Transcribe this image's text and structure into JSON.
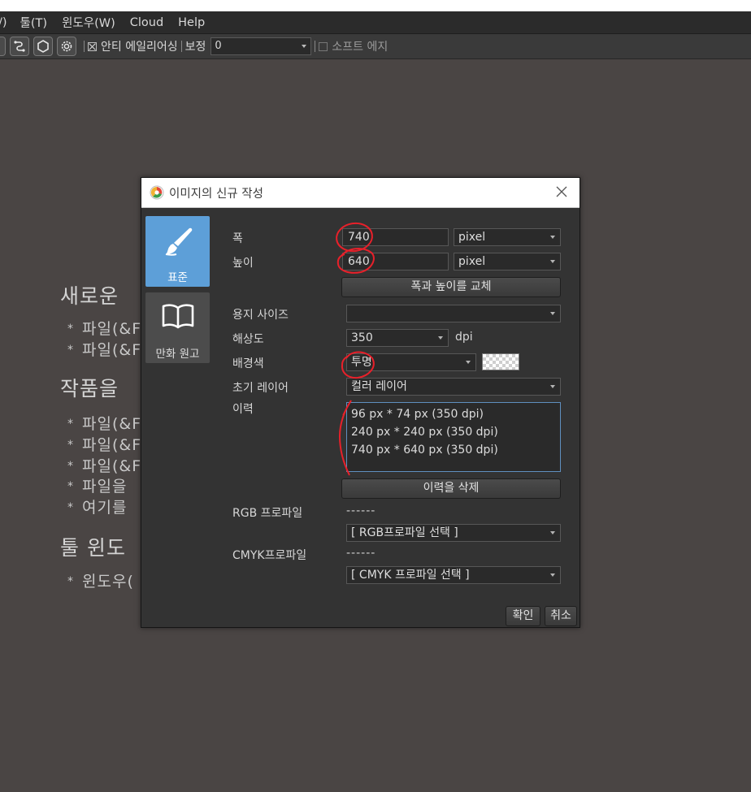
{
  "menubar": {
    "items": [
      "/)",
      "툴(T)",
      "윈도우(W)",
      "Cloud",
      "Help"
    ]
  },
  "toolbar": {
    "anti_alias_label": "안티 에일리어싱",
    "correction_label": "보정",
    "correction_value": "0",
    "soft_edge_label": "소프트 에지"
  },
  "background": {
    "headings": [
      "새로운",
      "작품을",
      "툴 윈도"
    ],
    "items_new": [
      "파일(&F",
      "파일(&F"
    ],
    "items_open": [
      "파일(&F",
      "파일(&F",
      "파일(&F",
      "파일을",
      "여기를"
    ],
    "items_tool": [
      "윈도우("
    ]
  },
  "dialog": {
    "title": "이미지의 신규 작성",
    "tabs": [
      {
        "label": "표준",
        "icon": "brush-icon"
      },
      {
        "label": "만화 원고",
        "icon": "book-icon"
      }
    ],
    "width_label": "폭",
    "width_value": "740",
    "width_unit": "pixel",
    "height_label": "높이",
    "height_value": "640",
    "height_unit": "pixel",
    "swap_button": "폭과 높이를 교체",
    "paper_size_label": "용지 사이즈",
    "paper_size_value": "",
    "resolution_label": "해상도",
    "resolution_value": "350",
    "resolution_unit": "dpi",
    "bg_color_label": "배경색",
    "bg_color_value": "투명",
    "initial_layer_label": "초기 레이어",
    "initial_layer_value": "컬러 레이어",
    "history_label": "이력",
    "history": [
      "96 px * 74 px (350 dpi)",
      "240 px * 240 px (350 dpi)",
      "740 px * 640 px (350 dpi)"
    ],
    "delete_history_button": "이력을 삭제",
    "rgb_profile_label": "RGB 프로파일",
    "rgb_profile_value": "------",
    "rgb_profile_select": "[ RGB프로파일 선택 ]",
    "cmyk_profile_label": "CMYK프로파일",
    "cmyk_profile_value": "------",
    "cmyk_profile_select": "[ CMYK 프로파일 선택 ]",
    "ok_button": "확인",
    "cancel_button": "취소"
  },
  "colors": {
    "canvas_bg": "#4a4544",
    "dialog_bg": "#333333",
    "active_tab": "#5d9fd8",
    "annotation": "#e8202a"
  }
}
